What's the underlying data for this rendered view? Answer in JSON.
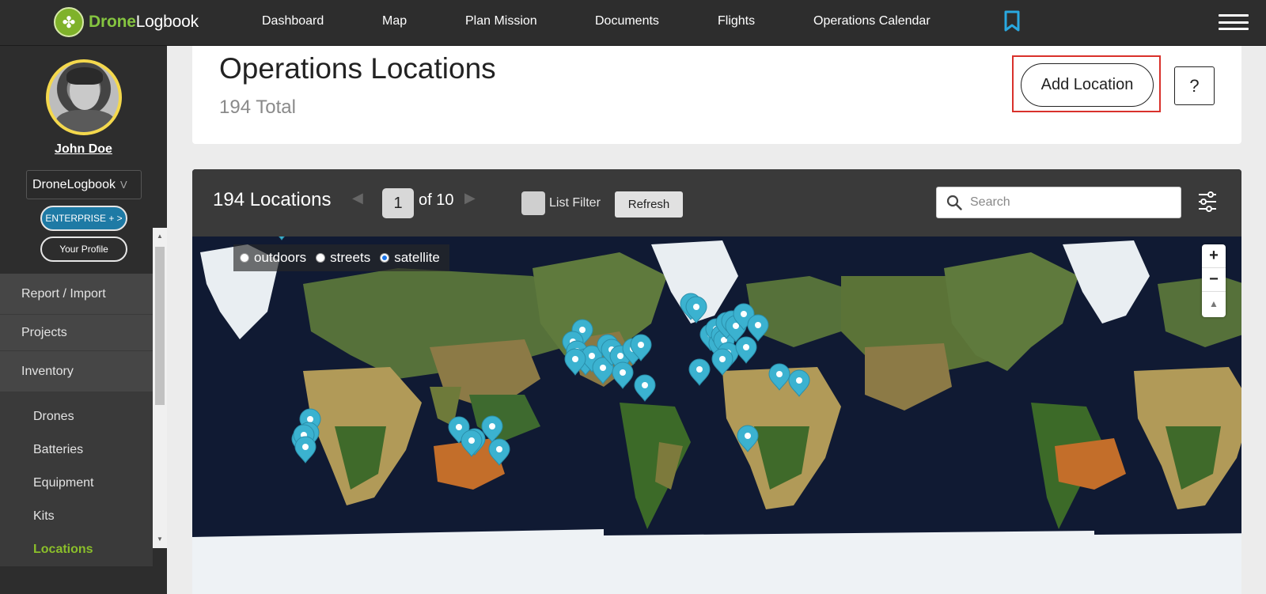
{
  "app": {
    "brand_part1": "Drone",
    "brand_part2": "Logbook"
  },
  "topnav": {
    "items": [
      "Dashboard",
      "Map",
      "Plan Mission",
      "Documents",
      "Flights",
      "Operations Calendar"
    ]
  },
  "sidebar": {
    "user_name": "John Doe",
    "org": "DroneLogbook",
    "org_chevron": "V",
    "enterprise_label": "ENTERPRISE + >",
    "profile_label": "Your Profile",
    "menu": [
      "Report / Import",
      "Projects",
      "Inventory"
    ],
    "submenu": [
      "Drones",
      "Batteries",
      "Equipment",
      "Kits",
      "Locations"
    ],
    "active_submenu": "Locations",
    "active_color": "#8bbf2a"
  },
  "header": {
    "title": "Operations Locations",
    "total": "194 Total",
    "add_label": "Add Location",
    "help_label": "?"
  },
  "toolbar": {
    "count_label": "194 Locations",
    "page_prev": "◀",
    "page_next": "▶",
    "page_current": "1",
    "page_of": "of 10",
    "list_filter_label": "List Filter",
    "refresh_label": "Refresh",
    "search_placeholder": "Search"
  },
  "map": {
    "layers": [
      {
        "label": "outdoors",
        "selected": false
      },
      {
        "label": "streets",
        "selected": false
      },
      {
        "label": "satellite",
        "selected": true
      }
    ],
    "zoom_in": "+",
    "zoom_out": "−",
    "reset_north": "▲",
    "marker_color": "#3bb2d0",
    "markers": [
      [
        356,
        180
      ],
      [
        392,
        546
      ],
      [
        390,
        563
      ],
      [
        382,
        571
      ],
      [
        384,
        566
      ],
      [
        386,
        581
      ],
      [
        736,
        433
      ],
      [
        724,
        448
      ],
      [
        729,
        460
      ],
      [
        740,
        470
      ],
      [
        748,
        466
      ],
      [
        762,
        481
      ],
      [
        768,
        452
      ],
      [
        773,
        458
      ],
      [
        784,
        466
      ],
      [
        787,
        487
      ],
      [
        800,
        457
      ],
      [
        810,
        452
      ],
      [
        815,
        503
      ],
      [
        727,
        470
      ],
      [
        873,
        400
      ],
      [
        880,
        404
      ],
      [
        884,
        483
      ],
      [
        898,
        439
      ],
      [
        905,
        432
      ],
      [
        909,
        450
      ],
      [
        912,
        440
      ],
      [
        915,
        446
      ],
      [
        918,
        424
      ],
      [
        920,
        462
      ],
      [
        925,
        422
      ],
      [
        930,
        428
      ],
      [
        940,
        413
      ],
      [
        943,
        455
      ],
      [
        958,
        427
      ],
      [
        913,
        470
      ],
      [
        985,
        489
      ],
      [
        1010,
        497
      ],
      [
        945,
        567
      ],
      [
        580,
        556
      ],
      [
        600,
        571
      ],
      [
        622,
        555
      ],
      [
        631,
        584
      ],
      [
        596,
        573
      ]
    ]
  }
}
